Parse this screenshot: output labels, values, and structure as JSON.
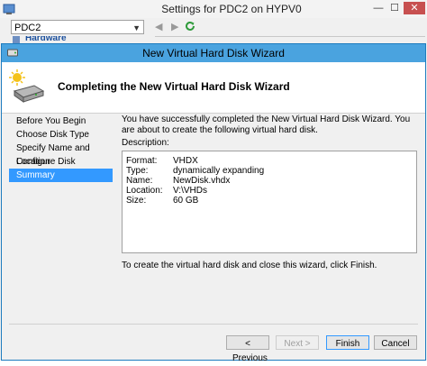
{
  "settings_window": {
    "title": "Settings for PDC2 on HYPV0",
    "vm_selector": "PDC2",
    "tree_first_item": "Hardware",
    "controls": {
      "minimize": "—",
      "maximize": "☐",
      "close": "✕"
    },
    "nav": {
      "back": "◀",
      "forward": "▶"
    }
  },
  "wizard": {
    "title": "New Virtual Hard Disk Wizard",
    "header_title": "Completing the New Virtual Hard Disk Wizard",
    "steps": [
      {
        "label": "Before You Begin",
        "active": false
      },
      {
        "label": "Choose Disk Type",
        "active": false
      },
      {
        "label": "Specify Name and Location",
        "active": false
      },
      {
        "label": "Configure Disk",
        "active": false
      },
      {
        "label": "Summary",
        "active": true
      }
    ],
    "intro_text": "You have successfully completed the New Virtual Hard Disk Wizard. You are about to create the following virtual hard disk.",
    "description_label": "Description:",
    "description": [
      {
        "key": "Format:",
        "value": "VHDX"
      },
      {
        "key": "Type:",
        "value": "dynamically expanding"
      },
      {
        "key": "Name:",
        "value": "NewDisk.vhdx"
      },
      {
        "key": "Location:",
        "value": "V:\\VHDs"
      },
      {
        "key": "Size:",
        "value": "60 GB"
      }
    ],
    "finish_note": "To create the virtual hard disk and close this wizard, click Finish.",
    "buttons": {
      "previous": "< Previous",
      "next": "Next >",
      "finish": "Finish",
      "cancel": "Cancel"
    }
  },
  "colors": {
    "title_bar": "#4aa3df",
    "selection": "#3399ff",
    "close_button": "#c75050"
  }
}
